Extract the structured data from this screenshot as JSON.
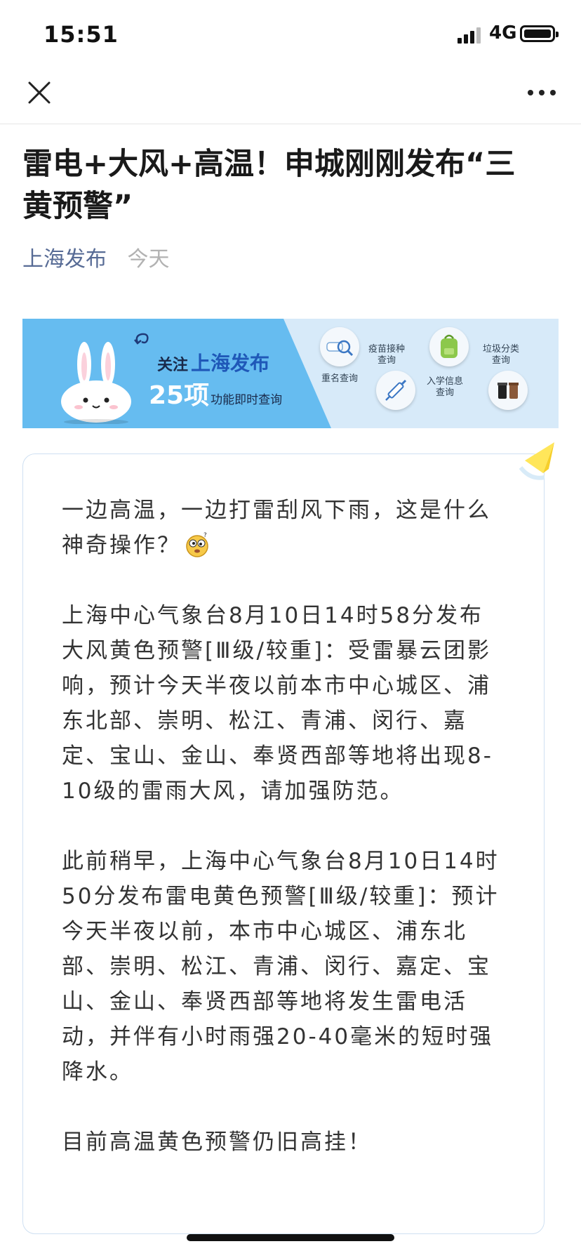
{
  "status_bar": {
    "time": "15:51",
    "network": "4G"
  },
  "nav": {
    "close_icon": "close-icon",
    "more_icon": "more-icon"
  },
  "article": {
    "title": "雷电+大风+高温！申城刚刚发布“三黄预警”",
    "author": "上海发布",
    "date": "今天"
  },
  "banner": {
    "follow_prefix": "关注",
    "follow_account": "上海发布",
    "count": "25项",
    "count_suffix": "功能即时查询",
    "features": [
      "重名查询",
      "疫苗接种查询",
      "入学信息查询",
      "垃圾分类查询"
    ]
  },
  "content": {
    "paragraphs": [
      "一边高温，一边打雷刮风下雨，这是什么神奇操作？",
      "上海中心气象台8月10日14时58分发布大风黄色预警[Ⅲ级/较重]：受雷暴云团影响，预计今天半夜以前本市中心城区、浦东北部、崇明、松江、青浦、闵行、嘉定、宝山、金山、奉贤西部等地将出现8-10级的雷雨大风，请加强防范。",
      "此前稍早，上海中心气象台8月10日14时50分发布雷电黄色预警[Ⅲ级/较重]：预计今天半夜以前，本市中心城区、浦东北部、崇明、松江、青浦、闵行、嘉定、宝山、金山、奉贤西部等地将发生雷电活动，并伴有小时雨强20-40毫米的短时强降水。",
      "目前高温黄色预警仍旧高挂！"
    ]
  },
  "colors": {
    "link": "#576b95",
    "muted": "#b2b2b2",
    "banner_blue": "#66bcf0",
    "accent_blue": "#1f58b8"
  }
}
